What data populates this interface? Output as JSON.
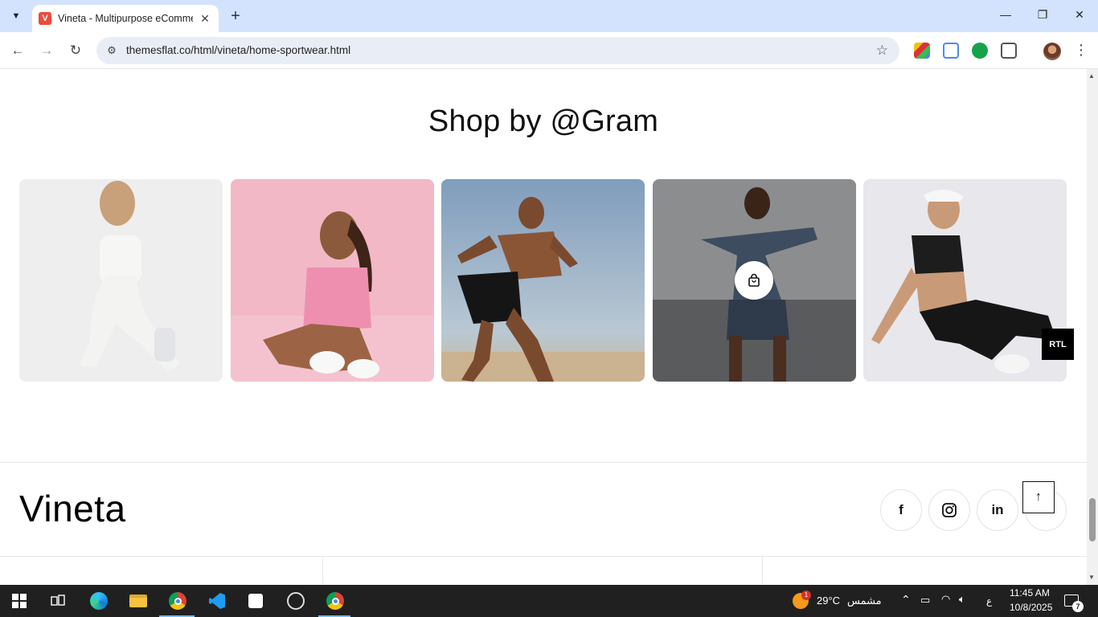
{
  "browser": {
    "tab_title": "Vineta - Multipurpose eCommerce",
    "favicon_letter": "V",
    "url": "themesflat.co/html/vineta/home-sportwear.html"
  },
  "page": {
    "section_title": "Shop by @Gram",
    "rtl_label": "RTL",
    "logo_text": "Vineta",
    "social": [
      "f",
      "in"
    ]
  },
  "taskbar": {
    "temperature": "29°C",
    "weather_label": "مشمس",
    "weather_badge": "1",
    "lang": "ع",
    "time": "11:45 AM",
    "date": "10/8/2025",
    "notifications": "7"
  },
  "colors": {
    "tabbar_bg": "#d3e3fd",
    "taskbar_bg": "#202020",
    "favicon_bg": "#ef4a3a"
  }
}
